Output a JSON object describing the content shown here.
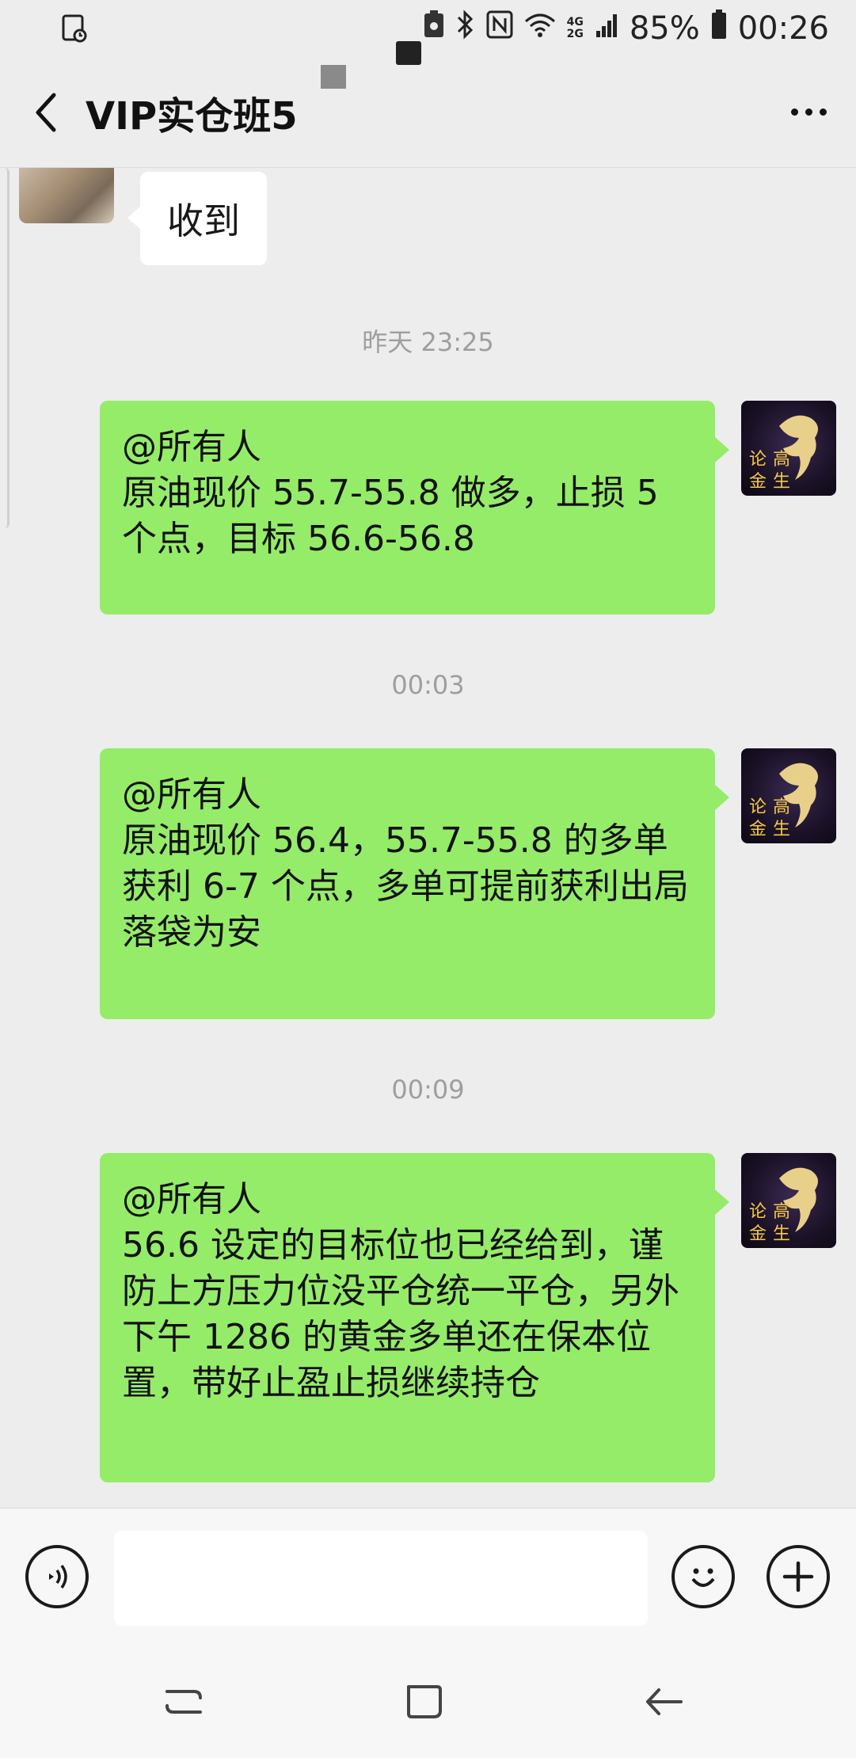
{
  "status_bar": {
    "network_4g": "4G",
    "network_2g": "2G",
    "battery": "85%",
    "time": "00:26"
  },
  "header": {
    "title": "VIP实仓班5",
    "back_icon": "chevron-left-icon",
    "more_icon": "more-icon"
  },
  "messages": [
    {
      "side": "left",
      "text": "收到"
    },
    {
      "type": "time",
      "text": "昨天 23:25"
    },
    {
      "side": "right",
      "text": "@所有人\n原油现价 55.7-55.8 做多，止损 5 个点，目标 56.6-56.8"
    },
    {
      "type": "time",
      "text": "00:03"
    },
    {
      "side": "right",
      "text": "@所有人\n原油现价 56.4，55.7-55.8 的多单获利 6-7 个点，多单可提前获利出局落袋为安"
    },
    {
      "type": "time",
      "text": "00:09"
    },
    {
      "side": "right",
      "text": "@所有人\n56.6 设定的目标位也已经给到，谨防上方压力位没平仓统一平仓，另外下午 1286 的黄金多单还在保本位置，带好止盈止损继续持仓"
    }
  ],
  "sender_avatar_text": [
    "论",
    "高",
    "金",
    "生"
  ],
  "input": {
    "voice_icon": "voice-icon",
    "emoji_icon": "emoji-icon",
    "plus_icon": "plus-icon",
    "value": ""
  },
  "colors": {
    "background": "#ededed",
    "bubble_mine": "#95ec69",
    "bubble_other": "#ffffff",
    "time_text": "#9e9e9e"
  }
}
